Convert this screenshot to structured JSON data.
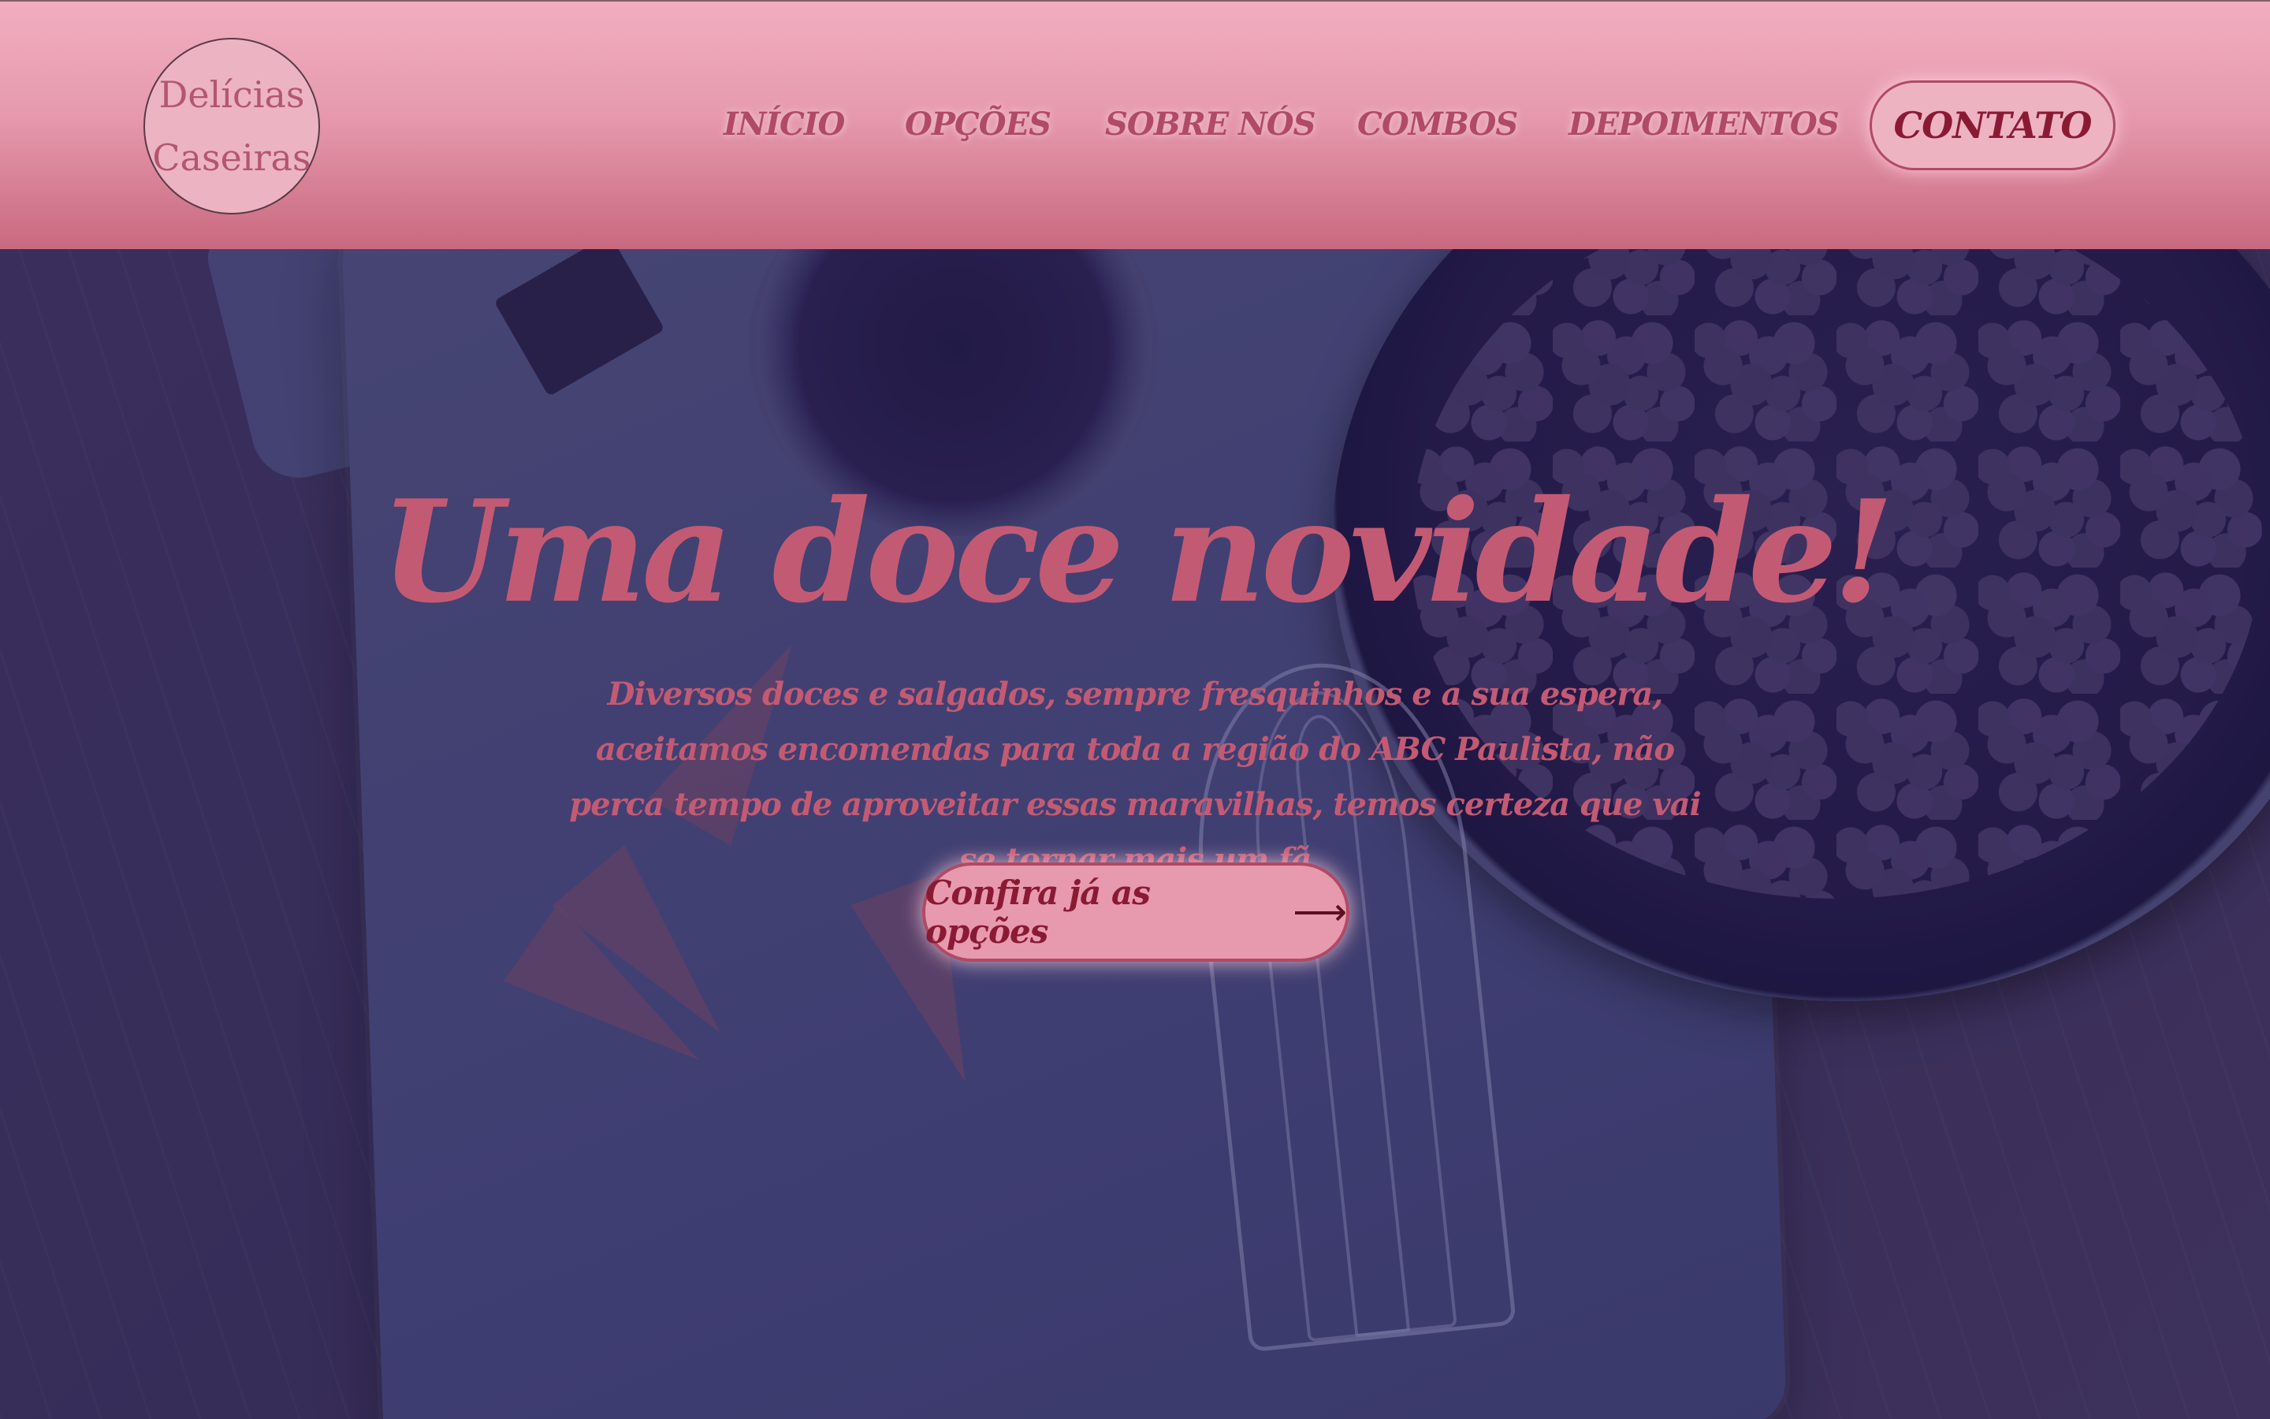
{
  "brand": {
    "logo_line1": "Delícias",
    "logo_line2": "Caseiras"
  },
  "nav": {
    "items": [
      {
        "label": "INÍCIO"
      },
      {
        "label": "OPÇÕES"
      },
      {
        "label": "SOBRE NÓS"
      },
      {
        "label": "COMBOS"
      },
      {
        "label": "DEPOIMENTOS"
      }
    ],
    "contact_label": "CONTATO"
  },
  "hero": {
    "title": "Uma doce novidade!",
    "text": "Diversos doces e salgados, sempre fresquinhos e a sua espera, aceitamos encomendas para toda a região do ABC Paulista, não perca tempo de aproveitar essas maravilhas, temos certeza que vai se tornar mais um fã",
    "cta_label": "Confira já as opções",
    "cta_icon": "arrow-right-icon"
  },
  "colors": {
    "header_top": "#f0aebf",
    "header_bottom": "#c9697f",
    "accent": "#c35a73",
    "button_text": "#8a1a34",
    "overlay": "#3a3560"
  }
}
